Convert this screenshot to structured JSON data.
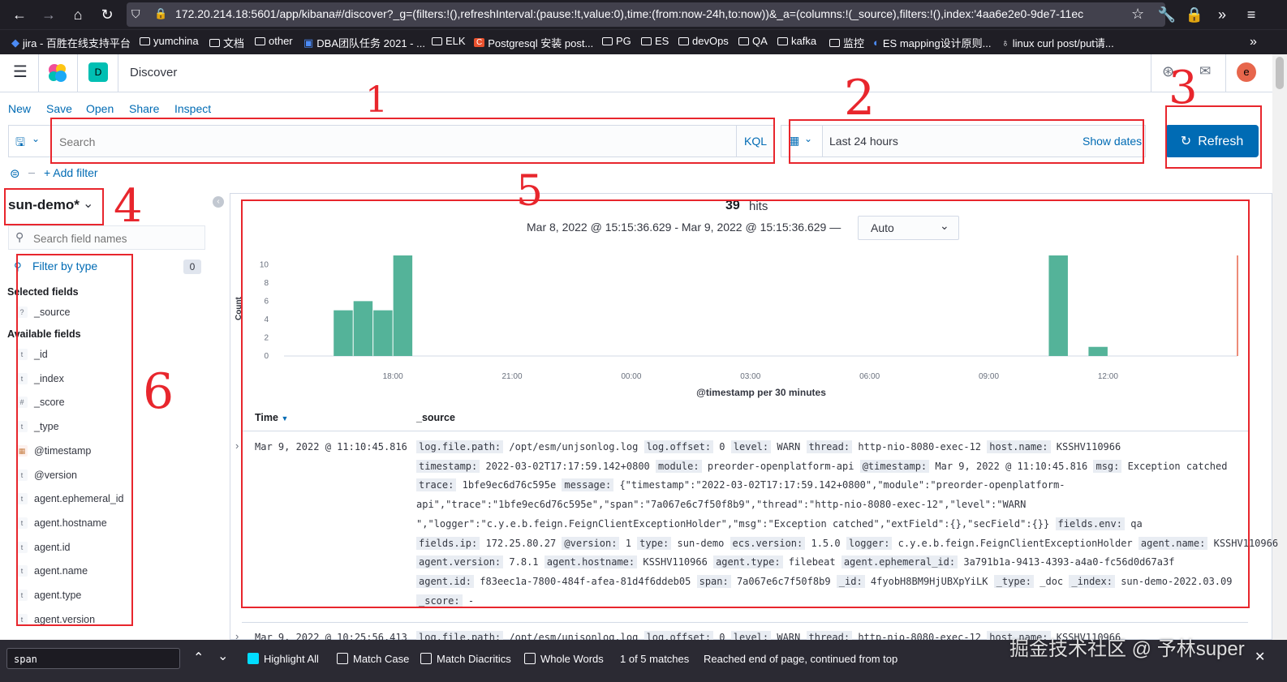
{
  "browser": {
    "url": "172.20.214.18:5601/app/kibana#/discover?_g=(filters:!(),refreshInterval:(pause:!t,value:0),time:(from:now-24h,to:now))&_a=(columns:!(_source),filters:!(),index:'4aa6e2e0-9de7-11ec",
    "bookmarks": [
      "jira - 百胜在线支持平台",
      "yumchina",
      "文档",
      "other",
      "DBA团队任务 2021 - ...",
      "ELK",
      "Postgresql 安装 post...",
      "PG",
      "ES",
      "devOps",
      "QA",
      "kafka",
      "监控",
      "ES mapping设计原则...",
      "linux curl post/put请..."
    ]
  },
  "header": {
    "space_letter": "D",
    "app_title": "Discover",
    "user_initial": "e"
  },
  "top_nav": [
    "New",
    "Save",
    "Open",
    "Share",
    "Inspect"
  ],
  "search": {
    "placeholder": "Search",
    "language": "KQL"
  },
  "time": {
    "range_label": "Last 24 hours",
    "show_dates": "Show dates",
    "refresh_label": "Refresh"
  },
  "filters": {
    "add_filter": "+ Add filter"
  },
  "sidebar": {
    "index_pattern": "sun-demo*",
    "field_search_placeholder": "Search field names",
    "filter_by_type": "Filter by type",
    "filter_count": "0",
    "selected_heading": "Selected fields",
    "selected_fields": [
      {
        "type": "?",
        "name": "_source"
      }
    ],
    "available_heading": "Available fields",
    "available_fields": [
      {
        "type": "t",
        "name": "_id"
      },
      {
        "type": "t",
        "name": "_index"
      },
      {
        "type": "#",
        "name": "_score"
      },
      {
        "type": "t",
        "name": "_type"
      },
      {
        "type": "cal",
        "name": "@timestamp"
      },
      {
        "type": "t",
        "name": "@version"
      },
      {
        "type": "t",
        "name": "agent.ephemeral_id"
      },
      {
        "type": "t",
        "name": "agent.hostname"
      },
      {
        "type": "t",
        "name": "agent.id"
      },
      {
        "type": "t",
        "name": "agent.name"
      },
      {
        "type": "t",
        "name": "agent.type"
      },
      {
        "type": "t",
        "name": "agent.version"
      }
    ]
  },
  "hits": {
    "count": "39",
    "label": "hits",
    "range": "Mar 8, 2022 @ 15:15:36.629 - Mar 9, 2022 @ 15:15:36.629 —",
    "interval": "Auto"
  },
  "chart_data": {
    "type": "bar",
    "xlabel": "@timestamp per 30 minutes",
    "ylabel": "Count",
    "ylim": [
      0,
      11
    ],
    "yticks": [
      0,
      2,
      4,
      6,
      8,
      10
    ],
    "xticks": [
      "18:00",
      "21:00",
      "00:00",
      "03:00",
      "06:00",
      "09:00",
      "12:00"
    ],
    "bar_color": "#54b399",
    "bins": [
      {
        "start": "2022-03-08 16:30",
        "count": 5
      },
      {
        "start": "2022-03-08 17:00",
        "count": 6
      },
      {
        "start": "2022-03-08 17:30",
        "count": 5
      },
      {
        "start": "2022-03-08 18:00",
        "count": 11
      },
      {
        "start": "2022-03-09 10:30",
        "count": 11
      },
      {
        "start": "2022-03-09 11:30",
        "count": 1
      }
    ]
  },
  "table": {
    "columns": [
      "Time",
      "_source"
    ],
    "rows": [
      {
        "time": "Mar 9, 2022 @ 11:10:45.816",
        "lines": [
          [
            [
              "log.file.path:",
              "/opt/esm/unjsonlog.log"
            ],
            [
              "log.offset:",
              "0"
            ],
            [
              "level:",
              "WARN"
            ],
            [
              "thread:",
              "http-nio-8080-exec-12"
            ],
            [
              "host.name:",
              "KSSHV110966"
            ]
          ],
          [
            [
              "timestamp:",
              "2022-03-02T17:17:59.142+0800"
            ],
            [
              "module:",
              "preorder-openplatform-api"
            ],
            [
              "@timestamp:",
              "Mar 9, 2022 @ 11:10:45.816"
            ],
            [
              "msg:",
              "Exception catched"
            ]
          ],
          [
            [
              "trace:",
              "1bfe9ec6d76c595e"
            ],
            [
              "message:",
              "{\"timestamp\":\"2022-03-02T17:17:59.142+0800\",\"module\":\"preorder-openplatform-"
            ]
          ],
          [
            [
              "",
              "api\",\"trace\":\"1bfe9ec6d76c595e\",\"span\":\"7a067e6c7f50f8b9\",\"thread\":\"http-nio-8080-exec-12\",\"level\":\"WARN"
            ]
          ],
          [
            [
              "",
              "\",\"logger\":\"c.y.e.b.feign.FeignClientExceptionHolder\",\"msg\":\"Exception catched\",\"extField\":{},\"secField\":{}}"
            ],
            [
              "fields.env:",
              "qa"
            ]
          ],
          [
            [
              "fields.ip:",
              "172.25.80.27"
            ],
            [
              "@version:",
              "1"
            ],
            [
              "type:",
              "sun-demo"
            ],
            [
              "ecs.version:",
              "1.5.0"
            ],
            [
              "logger:",
              "c.y.e.b.feign.FeignClientExceptionHolder"
            ],
            [
              "agent.name:",
              "KSSHV110966"
            ]
          ],
          [
            [
              "agent.version:",
              "7.8.1"
            ],
            [
              "agent.hostname:",
              "KSSHV110966"
            ],
            [
              "agent.type:",
              "filebeat"
            ],
            [
              "agent.ephemeral_id:",
              "3a791b1a-9413-4393-a4a0-fc56d0d67a3f"
            ]
          ],
          [
            [
              "agent.id:",
              "f83eec1a-7800-484f-afea-81d4f6ddeb05"
            ],
            [
              "span:",
              "7a067e6c7f50f8b9"
            ],
            [
              "_id:",
              "4fyobH8BM9HjUBXpYiLK"
            ],
            [
              "_type:",
              "_doc"
            ],
            [
              "_index:",
              "sun-demo-2022.03.09"
            ]
          ],
          [
            [
              "_score:",
              "-"
            ]
          ]
        ]
      },
      {
        "time": "Mar 9, 2022 @ 10:25:56.413",
        "lines": [
          [
            [
              "log.file.path:",
              "/opt/esm/unjsonlog.log"
            ],
            [
              "log.offset:",
              "0"
            ],
            [
              "level:",
              "WARN"
            ],
            [
              "thread:",
              "http-nio-8080-exec-12"
            ],
            [
              "host.name:",
              "KSSHV110966"
            ]
          ]
        ]
      }
    ]
  },
  "findbar": {
    "query": "span",
    "highlight_all": "Highlight All",
    "match_case": "Match Case",
    "match_diacritics": "Match Diacritics",
    "whole_words": "Whole Words",
    "matches": "1 of 5 matches",
    "status": "Reached end of page, continued from top"
  },
  "watermark": "掘金技术社区 @ 予林super",
  "annotations": [
    "1",
    "2",
    "3",
    "4",
    "5",
    "6"
  ]
}
